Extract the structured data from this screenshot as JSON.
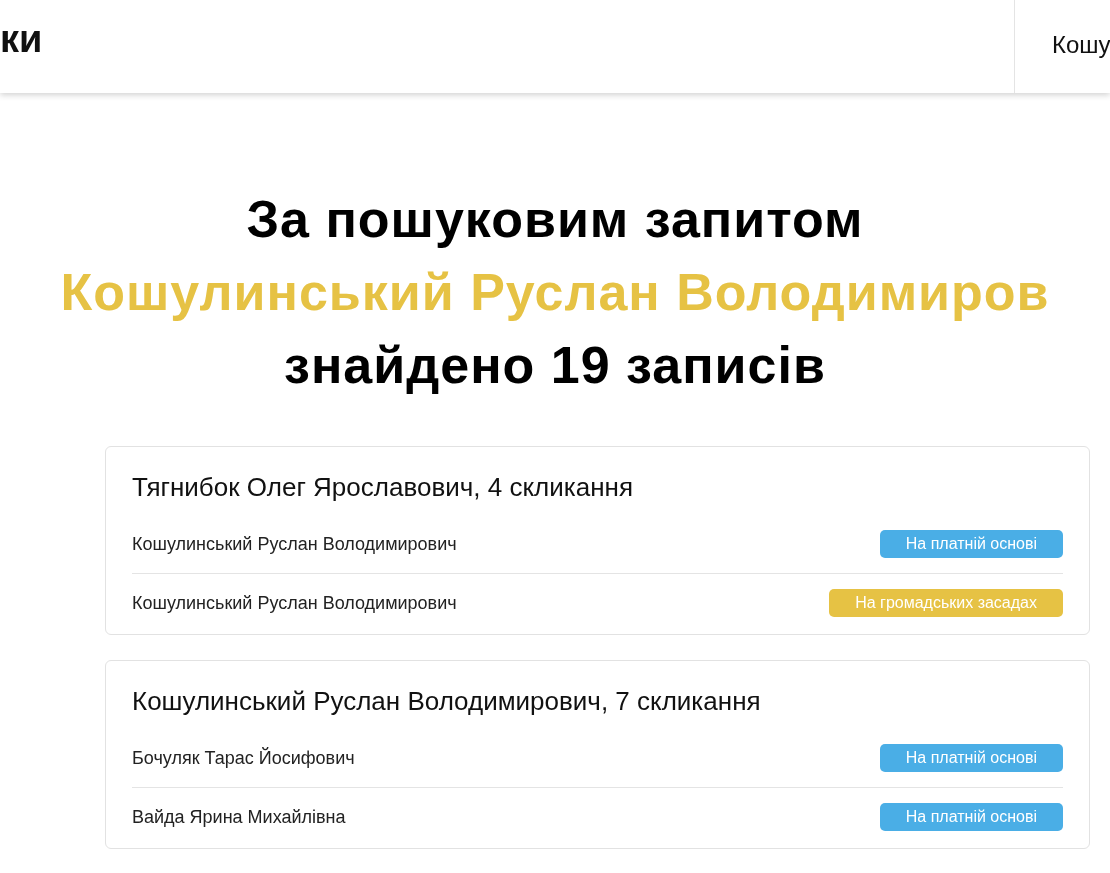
{
  "header": {
    "logo": "ки",
    "search_value": "Кошу"
  },
  "heading": {
    "line_1": "За пошуковим запитом",
    "query": "Кошулинський Руслан Володимиров",
    "line_3": "знайдено 19 записів"
  },
  "cards": [
    {
      "title": "Тягнибок Олег Ярославович, 4 скликання",
      "rows": [
        {
          "name": "Кошулинський Руслан Володимирович",
          "tag": "На платній основі",
          "color": "#4aaee6"
        },
        {
          "name": "Кошулинський Руслан Володимирович",
          "tag": "На громадських засадах",
          "color": "#e6c244"
        }
      ]
    },
    {
      "title": "Кошулинський Руслан Володимирович, 7 скликання",
      "rows": [
        {
          "name": "Бочуляк Тарас Йосифович",
          "tag": "На платній основі",
          "color": "#4aaee6"
        },
        {
          "name": "Вайда Ярина Михайлівна",
          "tag": "На платній основі",
          "color": "#4aaee6"
        }
      ]
    }
  ]
}
